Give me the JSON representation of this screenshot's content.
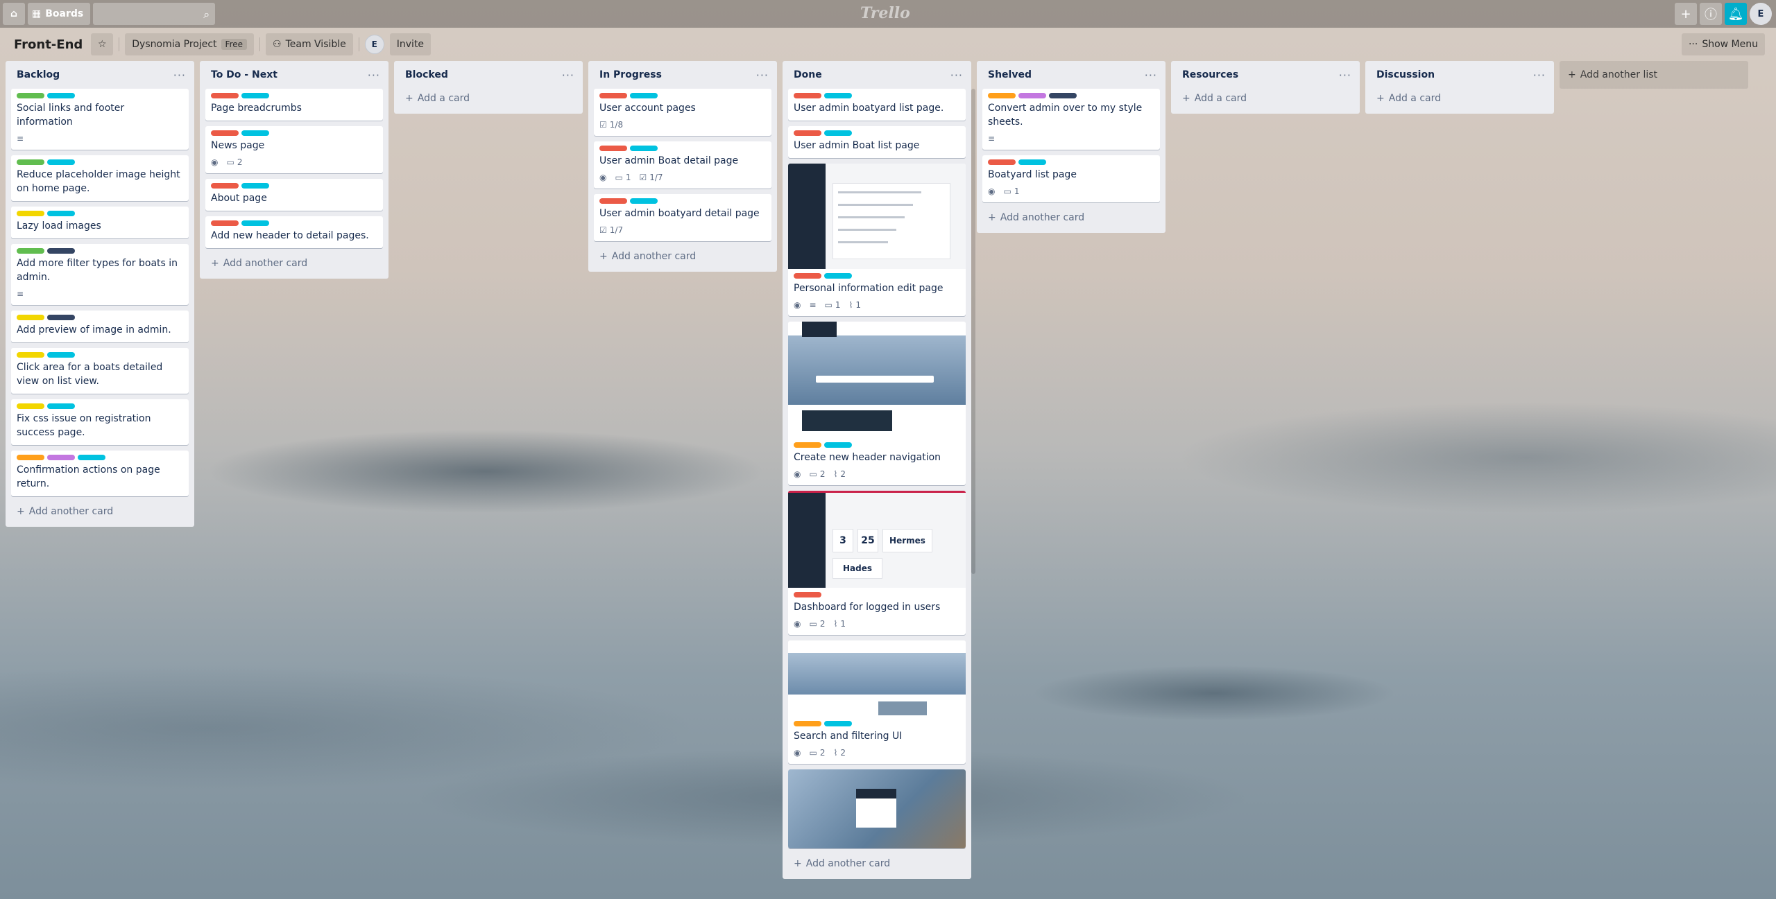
{
  "topbar": {
    "boards_label": "Boards",
    "logo": "Trello",
    "avatar_initial": "E"
  },
  "board": {
    "title": "Front-End",
    "team_name": "Dysnomia Project",
    "team_badge": "Free",
    "visibility": "Team Visible",
    "member_initial": "E",
    "invite_label": "Invite",
    "show_menu_label": "Show Menu"
  },
  "colors": {
    "green": "#61bd4f",
    "cyan": "#00c2e0",
    "red": "#eb5a46",
    "yellow": "#f2d600",
    "navy": "#344563",
    "orange": "#ff9f1a",
    "purple": "#c377e0"
  },
  "lists": [
    {
      "title": "Backlog",
      "add_label": "Add another card",
      "cards": [
        {
          "labels": [
            "green",
            "cyan"
          ],
          "title": "Social links and footer information",
          "badges": [
            {
              "icon": "description-icon",
              "text": ""
            }
          ]
        },
        {
          "labels": [
            "green",
            "cyan"
          ],
          "title": "Reduce placeholder image height on home page.",
          "badges": []
        },
        {
          "labels": [
            "yellow",
            "cyan"
          ],
          "title": "Lazy load images",
          "badges": []
        },
        {
          "labels": [
            "green",
            "navy"
          ],
          "title": "Add more filter types for boats in admin.",
          "badges": [
            {
              "icon": "description-icon",
              "text": ""
            }
          ]
        },
        {
          "labels": [
            "yellow",
            "navy"
          ],
          "title": "Add preview of image in admin.",
          "badges": []
        },
        {
          "labels": [
            "yellow",
            "cyan"
          ],
          "title": "Click area for a boats detailed view on list view.",
          "badges": []
        },
        {
          "labels": [
            "yellow",
            "cyan"
          ],
          "title": "Fix css issue on registration success page.",
          "badges": []
        },
        {
          "labels": [
            "orange",
            "purple",
            "cyan"
          ],
          "title": "Confirmation actions on page return.",
          "badges": []
        }
      ]
    },
    {
      "title": "To Do - Next",
      "add_label": "Add another card",
      "cards": [
        {
          "labels": [
            "red",
            "cyan"
          ],
          "title": "Page breadcrumbs",
          "badges": []
        },
        {
          "labels": [
            "red",
            "cyan"
          ],
          "title": "News page",
          "badges": [
            {
              "icon": "eye-icon",
              "text": ""
            },
            {
              "icon": "comment-icon",
              "text": "2"
            }
          ]
        },
        {
          "labels": [
            "red",
            "cyan"
          ],
          "title": "About page",
          "badges": []
        },
        {
          "labels": [
            "red",
            "cyan"
          ],
          "title": "Add new header to detail pages.",
          "badges": []
        }
      ]
    },
    {
      "title": "Blocked",
      "add_label": "Add a card",
      "cards": []
    },
    {
      "title": "In Progress",
      "add_label": "Add another card",
      "cards": [
        {
          "labels": [
            "red",
            "cyan"
          ],
          "title": "User account pages",
          "badges": [
            {
              "icon": "checklist-icon",
              "text": "1/8"
            }
          ]
        },
        {
          "labels": [
            "red",
            "cyan"
          ],
          "title": "User admin Boat detail page",
          "badges": [
            {
              "icon": "eye-icon",
              "text": ""
            },
            {
              "icon": "comment-icon",
              "text": "1"
            },
            {
              "icon": "checklist-icon",
              "text": "1/7"
            }
          ]
        },
        {
          "labels": [
            "red",
            "cyan"
          ],
          "title": "User admin boatyard detail page",
          "badges": [
            {
              "icon": "checklist-icon",
              "text": "1/7"
            }
          ]
        }
      ]
    },
    {
      "title": "Done",
      "add_label": "Add another card",
      "cards": [
        {
          "labels": [
            "red",
            "cyan"
          ],
          "title": "User admin boatyard list page.",
          "badges": []
        },
        {
          "labels": [
            "red",
            "cyan"
          ],
          "title": "User admin Boat list page",
          "badges": []
        },
        {
          "cover": "form",
          "labels": [
            "red",
            "cyan"
          ],
          "title": "Personal information edit page",
          "badges": [
            {
              "icon": "eye-icon",
              "text": ""
            },
            {
              "icon": "description-icon",
              "text": ""
            },
            {
              "icon": "comment-icon",
              "text": "1"
            },
            {
              "icon": "attachment-icon",
              "text": "1"
            }
          ]
        },
        {
          "cover": "hero",
          "labels": [
            "orange",
            "cyan"
          ],
          "title": "Create new header navigation",
          "badges": [
            {
              "icon": "eye-icon",
              "text": ""
            },
            {
              "icon": "comment-icon",
              "text": "2"
            },
            {
              "icon": "attachment-icon",
              "text": "2"
            }
          ]
        },
        {
          "cover": "dash",
          "labels": [
            "red"
          ],
          "title": "Dashboard for logged in users",
          "badges": [
            {
              "icon": "eye-icon",
              "text": ""
            },
            {
              "icon": "comment-icon",
              "text": "2"
            },
            {
              "icon": "attachment-icon",
              "text": "1"
            }
          ]
        },
        {
          "cover": "search",
          "labels": [
            "orange",
            "cyan"
          ],
          "title": "Search and filtering UI",
          "badges": [
            {
              "icon": "eye-icon",
              "text": ""
            },
            {
              "icon": "comment-icon",
              "text": "2"
            },
            {
              "icon": "attachment-icon",
              "text": "2"
            }
          ]
        },
        {
          "cover": "login",
          "labels": [],
          "title": "",
          "badges": []
        }
      ]
    },
    {
      "title": "Shelved",
      "add_label": "Add another card",
      "cards": [
        {
          "labels": [
            "orange",
            "purple",
            "navy"
          ],
          "title": "Convert admin over to my style sheets.",
          "badges": [
            {
              "icon": "description-icon",
              "text": ""
            }
          ]
        },
        {
          "labels": [
            "red",
            "cyan"
          ],
          "title": "Boatyard list page",
          "badges": [
            {
              "icon": "eye-icon",
              "text": ""
            },
            {
              "icon": "comment-icon",
              "text": "1"
            }
          ]
        }
      ]
    },
    {
      "title": "Resources",
      "add_label": "Add a card",
      "cards": []
    },
    {
      "title": "Discussion",
      "add_label": "Add a card",
      "cards": []
    }
  ],
  "add_list_label": "Add another list",
  "covers": {
    "dash_stats": [
      "3",
      "25",
      "Hermes",
      "Hades"
    ]
  }
}
